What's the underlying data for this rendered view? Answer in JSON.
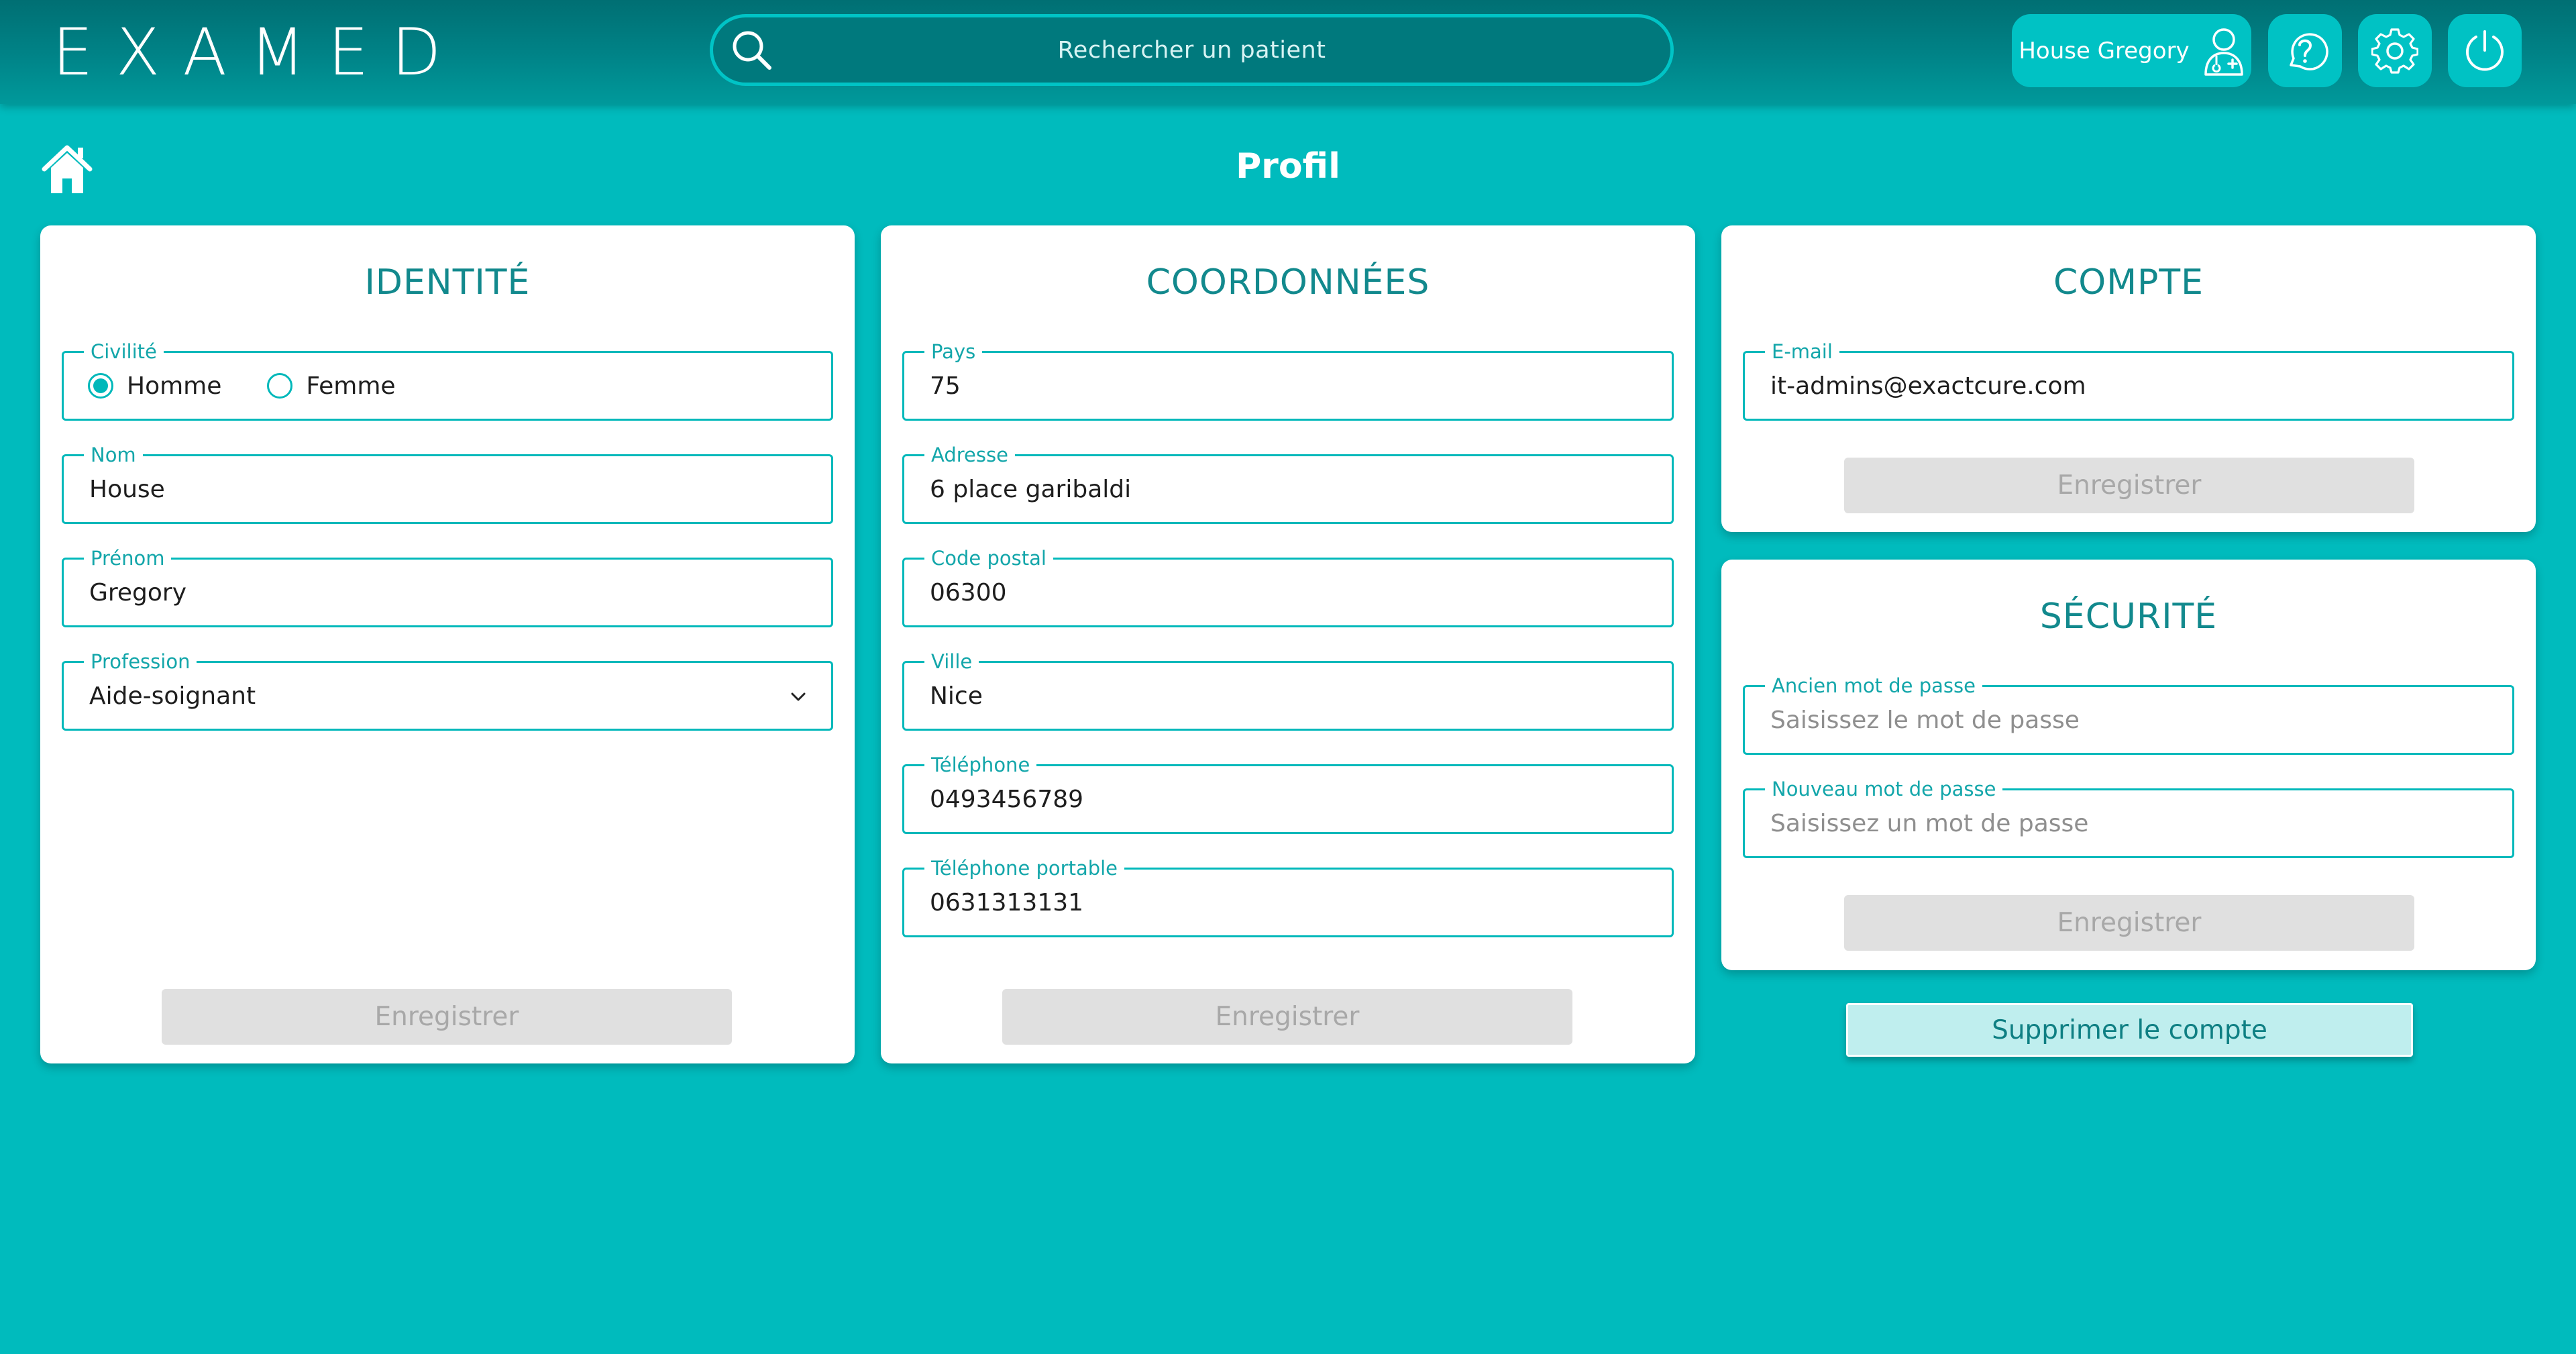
{
  "header": {
    "logo": "EXAMED",
    "search_placeholder": "Rechercher un patient",
    "user_name": "House Gregory"
  },
  "page": {
    "title": "Profil"
  },
  "identity": {
    "title": "IDENTITÉ",
    "civility_label": "Civilité",
    "civility_options": [
      "Homme",
      "Femme"
    ],
    "civility_selected": "Homme",
    "last_name_label": "Nom",
    "last_name": "House",
    "first_name_label": "Prénom",
    "first_name": "Gregory",
    "profession_label": "Profession",
    "profession": "Aide-soignant",
    "save_label": "Enregistrer"
  },
  "contact": {
    "title": "COORDONNÉES",
    "country_label": "Pays",
    "country": "75",
    "address_label": "Adresse",
    "address": "6 place garibaldi",
    "postal_code_label": "Code postal",
    "postal_code": "06300",
    "city_label": "Ville",
    "city": "Nice",
    "phone_label": "Téléphone",
    "phone": "0493456789",
    "mobile_label": "Téléphone portable",
    "mobile": "0631313131",
    "save_label": "Enregistrer"
  },
  "account": {
    "title": "COMPTE",
    "email_label": "E-mail",
    "email": "it-admins@exactcure.com",
    "save_label": "Enregistrer"
  },
  "security": {
    "title": "SÉCURITÉ",
    "old_password_label": "Ancien mot de passe",
    "old_password_placeholder": "Saisissez le mot de passe",
    "new_password_label": "Nouveau mot de passe",
    "new_password_placeholder": "Saisissez un mot de passe",
    "save_label": "Enregistrer"
  },
  "delete_account_label": "Supprimer le compte",
  "colors": {
    "background": "#00bbbd",
    "header": "#008488",
    "accent": "#00b8ba",
    "title_text": "#12898d"
  },
  "icons": [
    "search-icon",
    "user-doctor-icon",
    "help-icon",
    "gear-icon",
    "power-icon",
    "home-icon",
    "chevron-down-icon"
  ]
}
